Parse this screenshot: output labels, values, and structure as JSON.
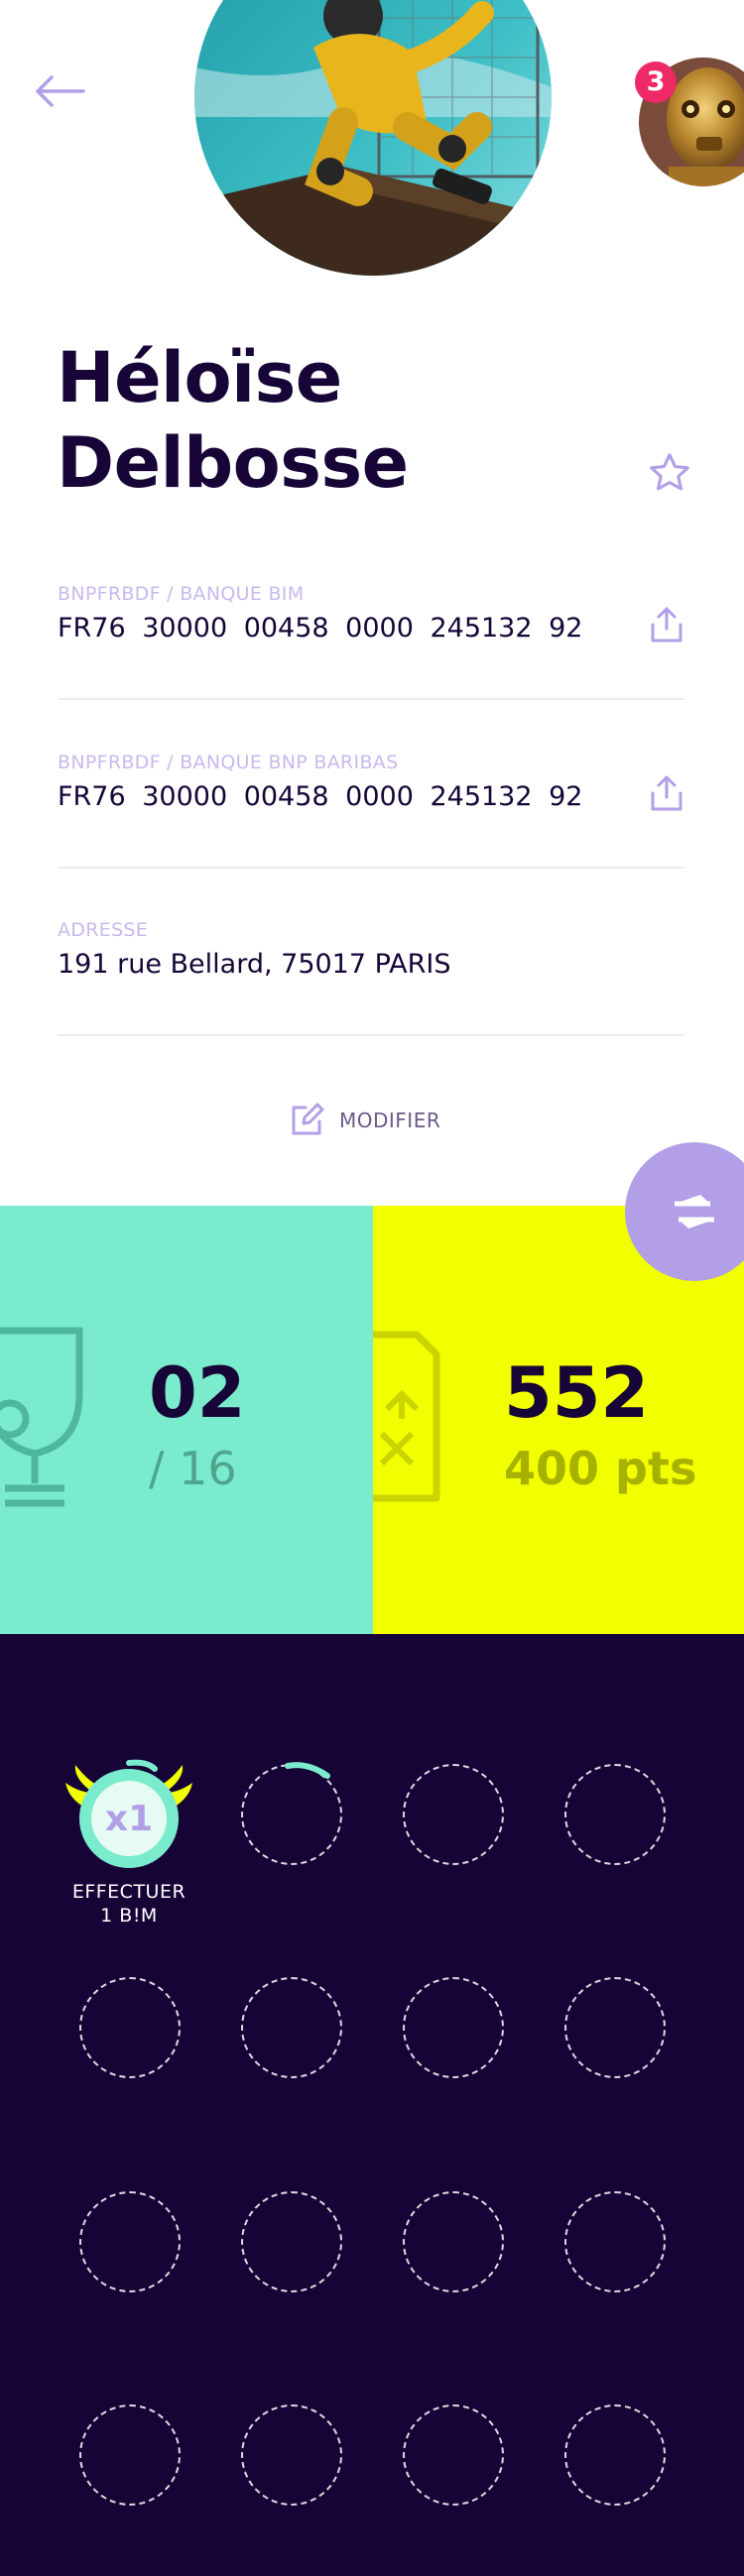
{
  "header": {
    "back_icon": "arrow-left-icon",
    "notification_count": "3",
    "accent_color": "#b39ee8"
  },
  "profile": {
    "first_name": "Héloïse",
    "last_name": "Delbosse"
  },
  "accounts": [
    {
      "label": "BNPFRBDF / BANQUE BIM",
      "iban": "FR76  30000  00458  0000  245132  92"
    },
    {
      "label": "BNPFRBDF / BANQUE BNP BARIBAS",
      "iban": "FR76  30000  00458  0000  245132  92"
    }
  ],
  "address": {
    "label": "ADRESSE",
    "value": "191 rue Bellard, 75017 PARIS"
  },
  "edit": {
    "label": "MODIFIER"
  },
  "stats": {
    "trophies": {
      "value": "02",
      "total": "/ 16",
      "color": "#7aeccd"
    },
    "points": {
      "value": "552",
      "sub": "400 pts",
      "color": "#f1ff00"
    }
  },
  "badges": {
    "active": {
      "multiplier": "x1",
      "label_line1": "EFFECTUER",
      "label_line2": "1 B!M"
    },
    "background_color": "#170436"
  }
}
